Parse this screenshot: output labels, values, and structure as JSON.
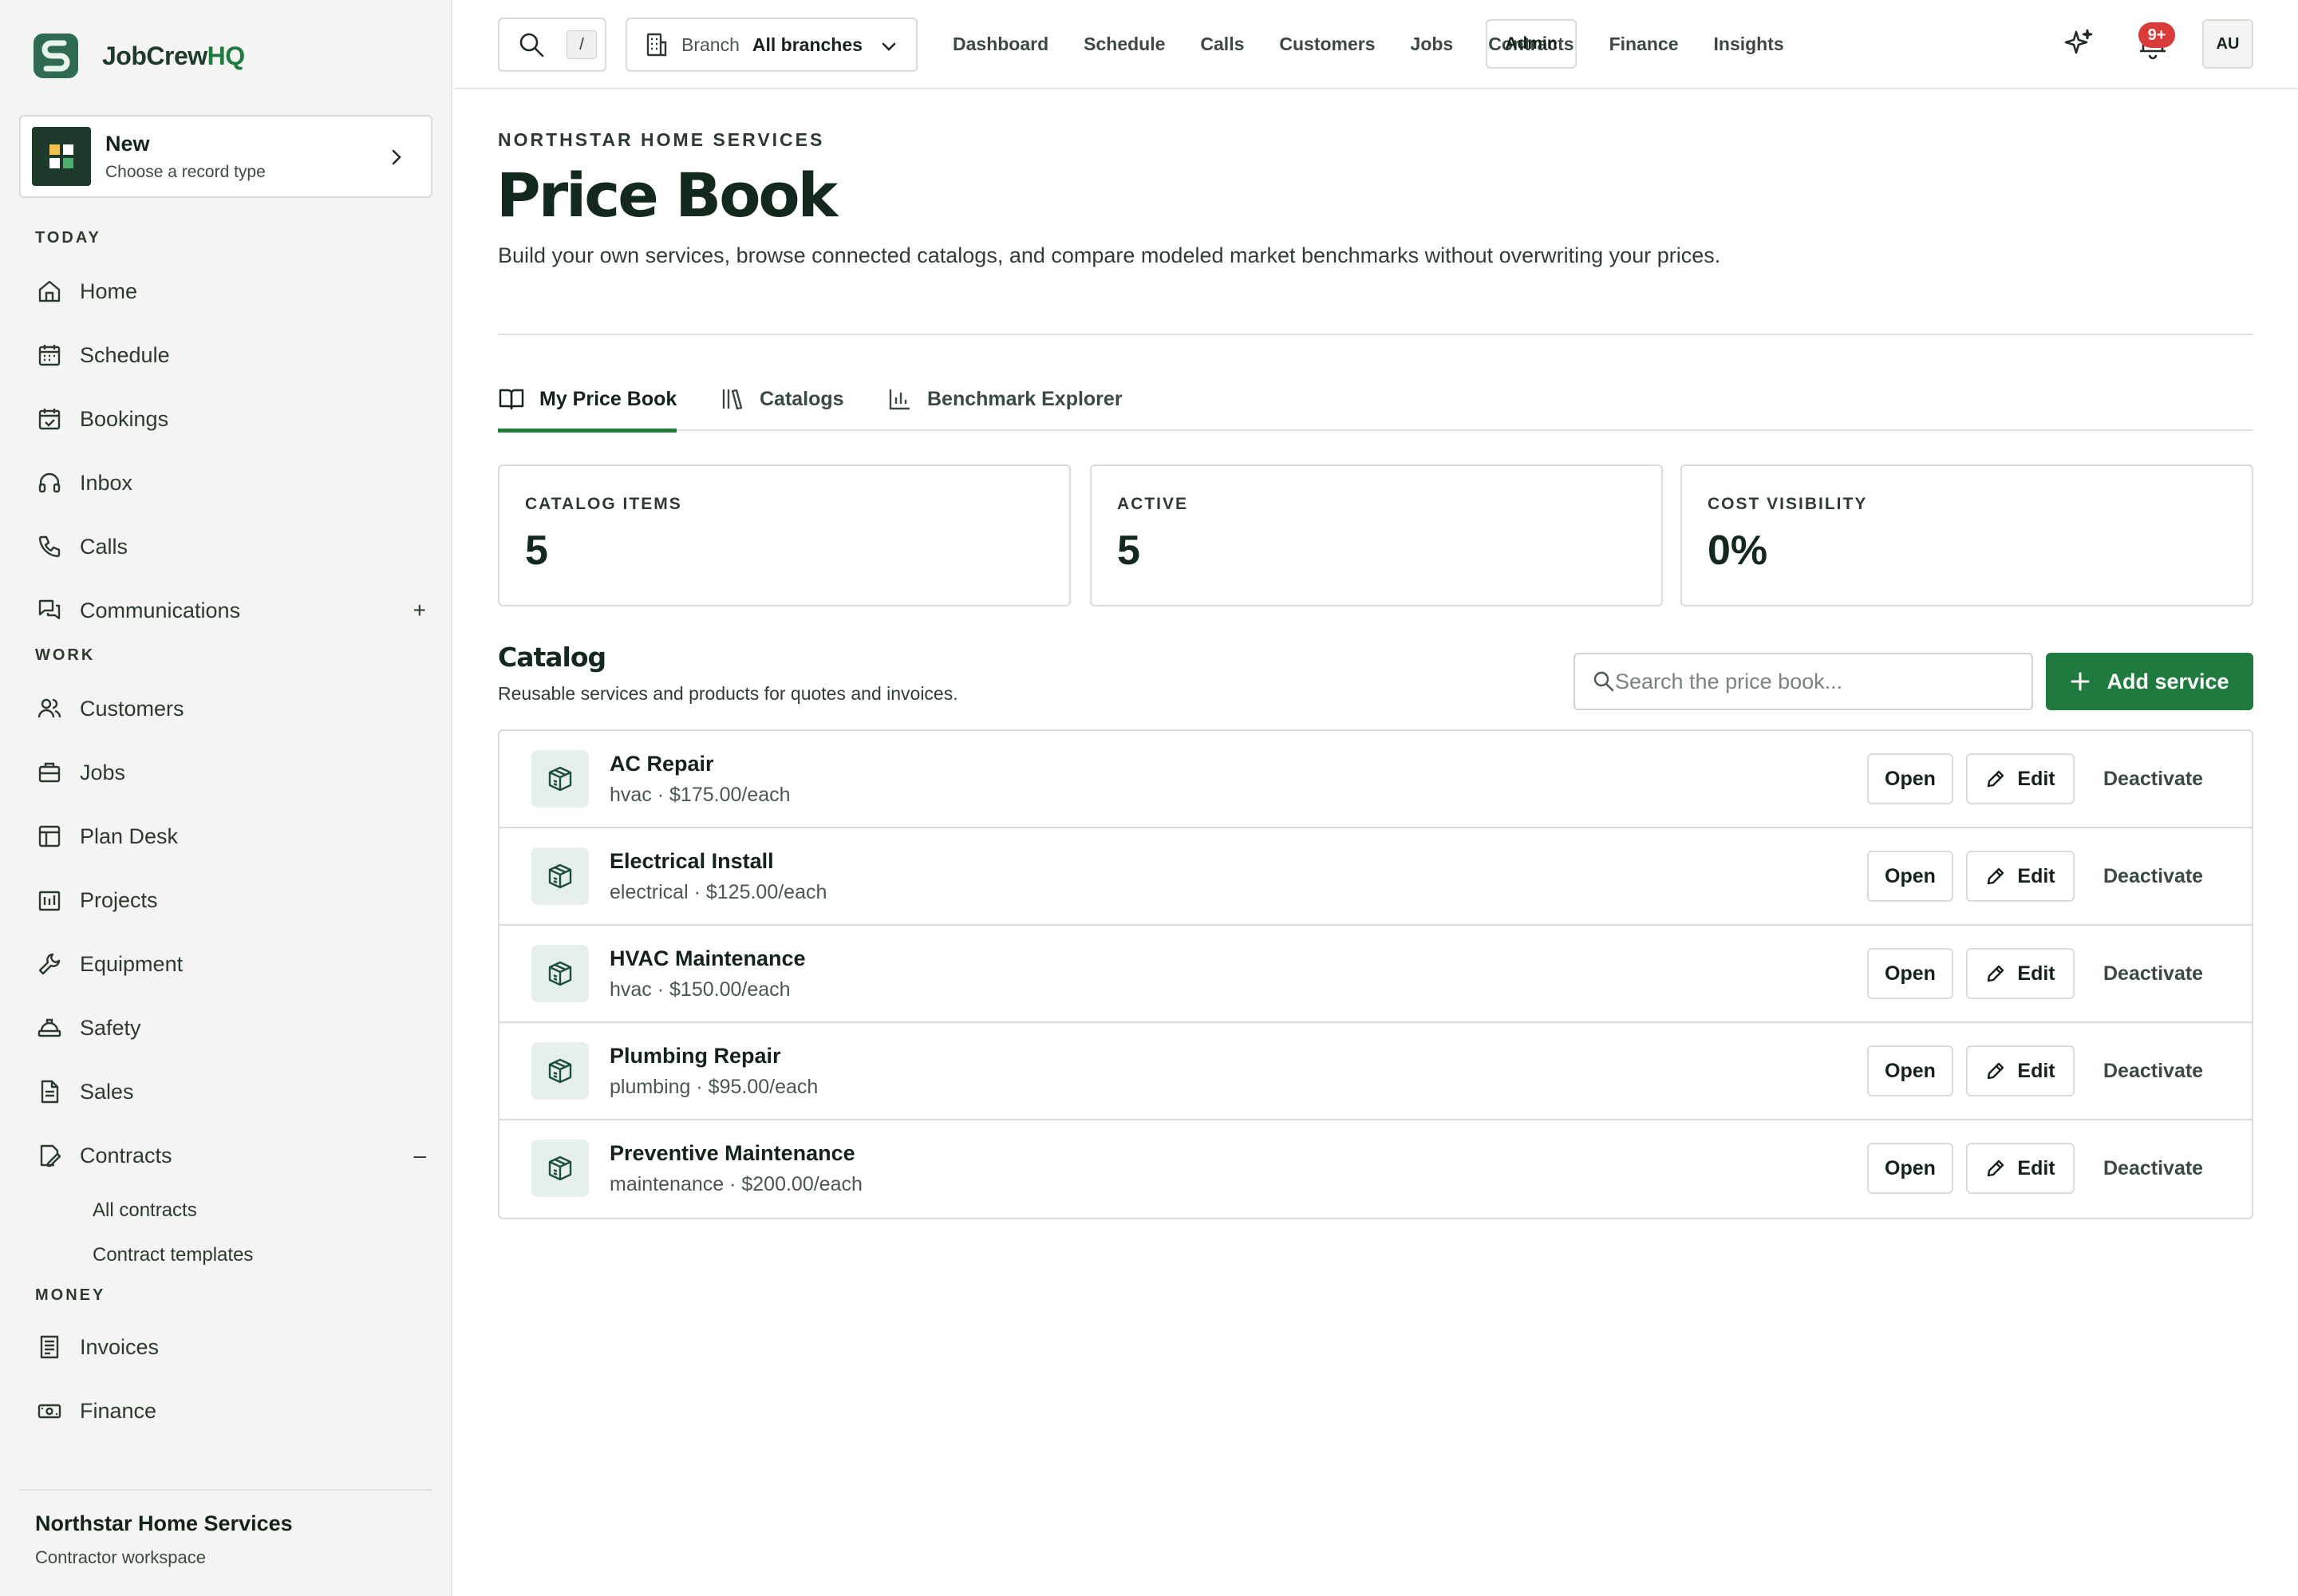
{
  "brand": {
    "name_main": "JobCrew",
    "name_accent": "HQ",
    "colors": {
      "primary": "#1f7a3f",
      "dark": "#1d3a2b",
      "badge": "#d93b3b"
    }
  },
  "new_card": {
    "title": "New",
    "subtitle": "Choose a record type"
  },
  "sidebar": {
    "sections": [
      {
        "label": "TODAY"
      },
      {
        "label": "WORK"
      },
      {
        "label": "MONEY"
      }
    ],
    "items": [
      {
        "label": "Home",
        "icon": "home-icon"
      },
      {
        "label": "Schedule",
        "icon": "calendar-icon"
      },
      {
        "label": "Bookings",
        "icon": "calendar-check-icon"
      },
      {
        "label": "Inbox",
        "icon": "headset-icon"
      },
      {
        "label": "Calls",
        "icon": "phone-icon"
      },
      {
        "label": "Communications",
        "icon": "chat-icon",
        "toggle": "+"
      },
      {
        "label": "Customers",
        "icon": "users-icon"
      },
      {
        "label": "Jobs",
        "icon": "briefcase-icon"
      },
      {
        "label": "Plan Desk",
        "icon": "layout-icon"
      },
      {
        "label": "Projects",
        "icon": "building-icon"
      },
      {
        "label": "Equipment",
        "icon": "wrench-icon"
      },
      {
        "label": "Safety",
        "icon": "hardhat-icon"
      },
      {
        "label": "Sales",
        "icon": "document-icon"
      },
      {
        "label": "Contracts",
        "icon": "contract-icon",
        "toggle": "–"
      },
      {
        "label": "Invoices",
        "icon": "receipt-icon"
      },
      {
        "label": "Finance",
        "icon": "cash-icon"
      }
    ],
    "subitems": [
      {
        "label": "All contracts"
      },
      {
        "label": "Contract templates"
      }
    ],
    "footer": {
      "org_name": "Northstar Home Services",
      "org_sub": "Contractor workspace"
    }
  },
  "topbar": {
    "search_shortcut": "/",
    "branch_label": "Branch",
    "branch_value": "All branches",
    "nav": [
      "Dashboard",
      "Schedule",
      "Calls",
      "Customers",
      "Jobs",
      "Contracts",
      "Finance",
      "Insights"
    ],
    "admin_label": "Admin",
    "notifications_badge": "9+",
    "avatar_initials": "AU"
  },
  "page": {
    "eyebrow": "NORTHSTAR HOME SERVICES",
    "title": "Price Book",
    "description": "Build your own services, browse connected catalogs, and compare modeled market benchmarks without overwriting your prices."
  },
  "tabs": [
    {
      "label": "My Price Book",
      "icon": "book-icon",
      "active": true
    },
    {
      "label": "Catalogs",
      "icon": "library-icon",
      "active": false
    },
    {
      "label": "Benchmark Explorer",
      "icon": "bar-chart-icon",
      "active": false
    }
  ],
  "stats": [
    {
      "label": "CATALOG ITEMS",
      "value": "5"
    },
    {
      "label": "ACTIVE",
      "value": "5"
    },
    {
      "label": "COST VISIBILITY",
      "value": "0%"
    }
  ],
  "catalog": {
    "title": "Catalog",
    "subtitle": "Reusable services and products for quotes and invoices.",
    "search_placeholder": "Search the price book...",
    "add_label": "Add service",
    "open_label": "Open",
    "edit_label": "Edit",
    "deactivate_label": "Deactivate",
    "items": [
      {
        "name": "AC Repair",
        "meta": "hvac · $175.00/each"
      },
      {
        "name": "Electrical Install",
        "meta": "electrical · $125.00/each"
      },
      {
        "name": "HVAC Maintenance",
        "meta": "hvac · $150.00/each"
      },
      {
        "name": "Plumbing Repair",
        "meta": "plumbing · $95.00/each"
      },
      {
        "name": "Preventive Maintenance",
        "meta": "maintenance · $200.00/each"
      }
    ]
  }
}
